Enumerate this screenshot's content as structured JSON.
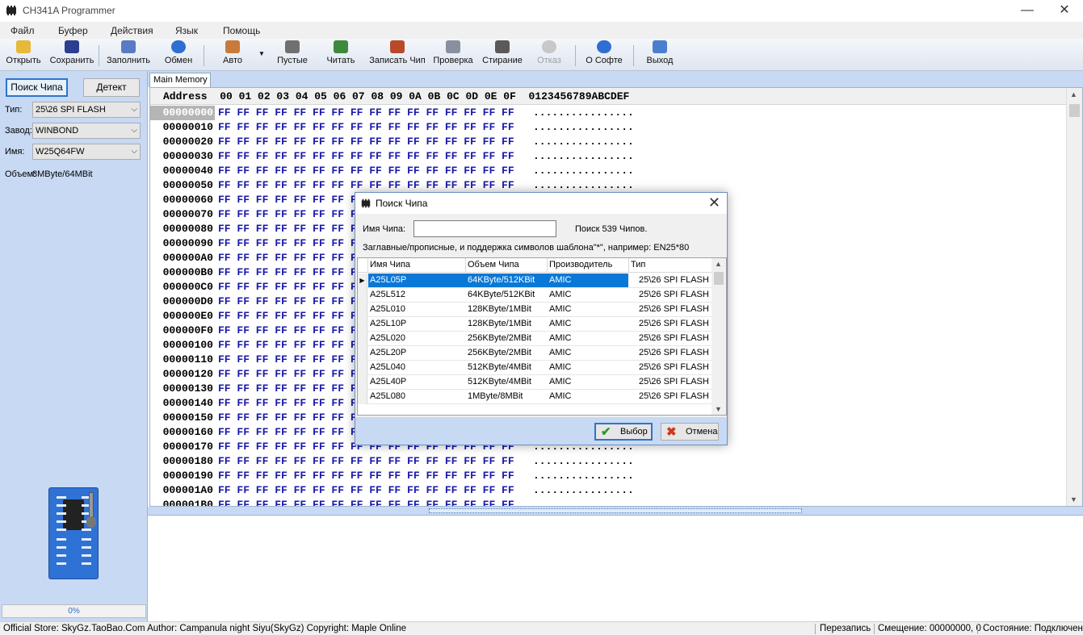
{
  "window": {
    "title": "CH341A Programmer",
    "minimize": "—",
    "maximize": "☐",
    "close": "✕"
  },
  "menu": [
    "Файл",
    "Буфер",
    "Действия",
    "Язык",
    "Помощь"
  ],
  "toolbar": {
    "open": "Открыть",
    "save": "Сохранить",
    "fill": "Заполнить",
    "swap": "Обмен",
    "auto": "Авто",
    "blank": "Пустые",
    "read": "Читать",
    "write": "Записать Чип",
    "verify": "Проверка",
    "erase": "Стирание",
    "cancel": "Отказ",
    "about": "О Софте",
    "exit": "Выход"
  },
  "left_panel": {
    "search_button": "Поиск Чипа",
    "detect_button": "Детект",
    "type_label": "Тип:",
    "type_value": "25\\26 SPI FLASH",
    "vendor_label": "Завод:",
    "vendor_value": "WINBOND",
    "name_label": "Имя:",
    "name_value": "W25Q64FW",
    "size_label": "Объем:",
    "size_value": "8MByte/64MBit",
    "progress_text": "0%",
    "progress_fraction": 0
  },
  "tab": "Main Memory",
  "hex": {
    "header_address": "Address",
    "header_cols": "00 01 02 03 04 05 06 07 08 09 0A 0B 0C 0D 0E 0F",
    "header_ascii": "0123456789ABCDEF",
    "row_bytes": "FF FF FF FF FF FF FF FF FF FF FF FF FF FF FF FF",
    "row_ascii": "................",
    "addresses": [
      "00000000",
      "00000010",
      "00000020",
      "00000030",
      "00000040",
      "00000050",
      "00000060",
      "00000070",
      "00000080",
      "00000090",
      "000000A0",
      "000000B0",
      "000000C0",
      "000000D0",
      "000000E0",
      "000000F0",
      "00000100",
      "00000110",
      "00000120",
      "00000130",
      "00000140",
      "00000150",
      "00000160",
      "00000170",
      "00000180",
      "00000190",
      "000001A0",
      "000001B0"
    ]
  },
  "status": {
    "info": "Official Store: SkyGz.TaoBao.Com Author: Campanula night Siyu(SkyGz) Copyright: Maple Online",
    "mode": "Перезапись",
    "offset": "Смещение: 00000000, 0",
    "state": "Состояние: Подключен"
  },
  "dialog": {
    "title": "Поиск Чипа",
    "name_label": "Имя Чипа:",
    "name_value": "",
    "count_text": "Поиск 539 Чипов.",
    "hint": "Заглавные/прописные, и поддержка символов шаблона\"*\", например: EN25*80",
    "columns": [
      "Имя Чипа",
      "Объем Чипа",
      "Производитель",
      "Тип"
    ],
    "rows": [
      [
        "A25L05P",
        "64KByte/512KBit",
        "AMIC",
        "25\\26 SPI FLASH"
      ],
      [
        "A25L512",
        "64KByte/512KBit",
        "AMIC",
        "25\\26 SPI FLASH"
      ],
      [
        "A25L010",
        "128KByte/1MBit",
        "AMIC",
        "25\\26 SPI FLASH"
      ],
      [
        "A25L10P",
        "128KByte/1MBit",
        "AMIC",
        "25\\26 SPI FLASH"
      ],
      [
        "A25L020",
        "256KByte/2MBit",
        "AMIC",
        "25\\26 SPI FLASH"
      ],
      [
        "A25L20P",
        "256KByte/2MBit",
        "AMIC",
        "25\\26 SPI FLASH"
      ],
      [
        "A25L040",
        "512KByte/4MBit",
        "AMIC",
        "25\\26 SPI FLASH"
      ],
      [
        "A25L40P",
        "512KByte/4MBit",
        "AMIC",
        "25\\26 SPI FLASH"
      ],
      [
        "A25L080",
        "1MByte/8MBit",
        "AMIC",
        "25\\26 SPI FLASH"
      ]
    ],
    "ok_button": "Выбор",
    "cancel_button": "Отмена"
  },
  "colors": {
    "panel_bg": "#c7d9f3",
    "hex_bytes": "#1a1aa8",
    "selection": "#0a78d7",
    "accent": "#2e74c9"
  },
  "icons": [
    "app-chip-icon",
    "open-folder-icon",
    "save-disk-icon",
    "fill-pencil-icon",
    "swap-arrows-icon",
    "auto-icon",
    "blank-icon",
    "read-icon",
    "write-icon",
    "verify-icon",
    "erase-icon",
    "cancel-icon",
    "about-info-icon",
    "exit-door-icon",
    "checkmark-icon",
    "cross-icon"
  ]
}
